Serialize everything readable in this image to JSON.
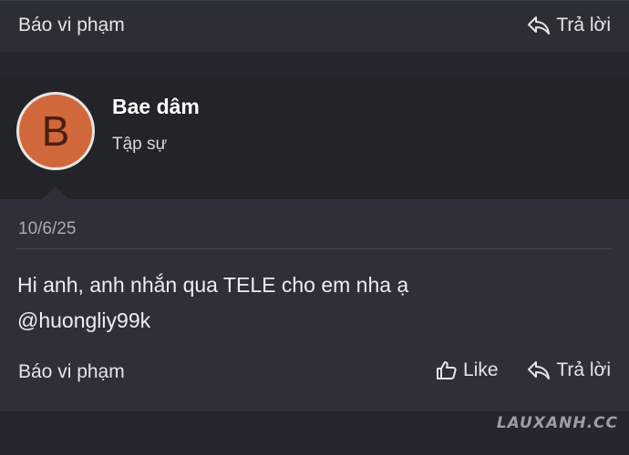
{
  "top_bar": {
    "report_label": "Báo vi phạm",
    "reply_label": "Trả lời"
  },
  "post": {
    "avatar_letter": "B",
    "username": "Bae dâm",
    "user_title": "Tập sự",
    "date": "10/6/25",
    "body_lines": [
      "Hi anh, anh nhắn qua TELE cho em nha ạ",
      "@huongliy99k"
    ],
    "report_label": "Báo vi phạm",
    "like_label": "Like",
    "reply_label": "Trả lời"
  },
  "watermark": "LAUXANH.CC",
  "colors": {
    "background": "#24272d",
    "header_bg": "#222429",
    "post_bg": "#2d3038",
    "avatar_bg": "#d0683c"
  },
  "icons": {
    "reply": "reply-icon",
    "like": "thumbs-up-icon"
  }
}
